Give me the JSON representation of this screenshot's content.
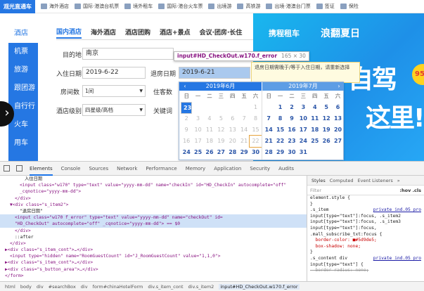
{
  "topnav": {
    "logo": "观光直通车",
    "items": [
      "海外酒店",
      "国际·港澳台机票",
      "境外租车",
      "国际·港台火车票",
      "出境游",
      "高铁游",
      "出境·港澳台门票",
      "签证",
      "保险"
    ]
  },
  "sidebar": {
    "items": [
      "酒店",
      "机票",
      "旅游",
      "跟团游",
      "自行行",
      "火车",
      "用车"
    ],
    "active": 0
  },
  "tabs": {
    "items": [
      "国内酒店",
      "海外酒店",
      "酒店团购",
      "酒店+景点",
      "会议·团房·长住"
    ],
    "active": 0
  },
  "form": {
    "destination_label": "目的地",
    "destination_value": "南京",
    "checkin_label": "入住日期",
    "checkin_value": "2019-6-22",
    "checkout_label": "退房日期",
    "checkout_value": "2019-6-21",
    "rooms_label": "房间数",
    "rooms_value": "1间",
    "guests_label": "住客数",
    "level_label": "酒店级别",
    "level_value": "四星级/高档",
    "keyword_label": "关键词"
  },
  "inspector_tooltip": {
    "selector": "input#HD_CheckOut.w170.f_error",
    "size": "165 × 30"
  },
  "error_tip": "退房日期需晚于/等于入住日期，请重新选择",
  "banner": {
    "brand": "携程租车",
    "slogan": "浪翻夏日",
    "big1": "自驾",
    "big2": "这里!",
    "badge": "95"
  },
  "calendar": {
    "left_title": "2019年6月",
    "right_title": "2019年7月",
    "weekdays": [
      "日",
      "一",
      "二",
      "三",
      "四",
      "五",
      "六"
    ],
    "left_days": [
      "",
      "",
      "",
      "",
      "",
      "",
      "1",
      "2",
      "3",
      "4",
      "5",
      "6",
      "7",
      "8",
      "9",
      "10",
      "11",
      "12",
      "13",
      "14",
      "15",
      "16",
      "17",
      "18",
      "19",
      "20",
      "21",
      "22",
      "23",
      "24",
      "25",
      "26",
      "27",
      "28",
      "29",
      "30",
      "",
      "",
      "",
      "",
      "",
      ""
    ],
    "right_days": [
      "",
      "1",
      "2",
      "3",
      "4",
      "5",
      "6",
      "7",
      "8",
      "9",
      "10",
      "11",
      "12",
      "13",
      "14",
      "15",
      "16",
      "17",
      "18",
      "19",
      "20",
      "21",
      "22",
      "23",
      "24",
      "25",
      "26",
      "27",
      "28",
      "29",
      "30",
      "31",
      "",
      "",
      ""
    ],
    "left_selected": "23",
    "left_range_start": "22",
    "prev_label": "‹",
    "next_label": "›"
  },
  "devtools": {
    "tabs": [
      "Elements",
      "Console",
      "Sources",
      "Network",
      "Performance",
      "Memory",
      "Application",
      "Security",
      "Audits"
    ],
    "active_tab": 0,
    "dom_lines": [
      {
        "indent": 10,
        "text": "入住日期",
        "kind": "text"
      },
      {
        "indent": 8,
        "text": "<input class=\"w170\" type=\"text\" value=\"yyyy-mm-dd\" name=\"checkIn\" id=\"HD_CheckIn\" autocomplete=\"off\"",
        "kind": "tag"
      },
      {
        "indent": 8,
        "text": "_cqnotice=\"yyyy-mm-dd\">",
        "kind": "tag"
      },
      {
        "indent": 6,
        "text": "</div>",
        "kind": "tag"
      },
      {
        "indent": 4,
        "text": "▼<div class=\"s_item2\">",
        "kind": "tag"
      },
      {
        "indent": 8,
        "text": "\"退房日期\"",
        "kind": "text"
      },
      {
        "indent": 6,
        "text": "<input class=\"w170 f_error\" type=\"text\" value=\"yyyy-mm-dd\" name=\"checkOut\" id=",
        "kind": "tag",
        "hl": true
      },
      {
        "indent": 6,
        "text": "\"HD_CheckOut\" autocomplete=\"off\" _cqnotice=\"yyyy-mm-dd\"> == $0",
        "kind": "tag",
        "hl": true
      },
      {
        "indent": 6,
        "text": "</div>",
        "kind": "tag"
      },
      {
        "indent": 6,
        "text": "::after",
        "kind": "text"
      },
      {
        "indent": 4,
        "text": "</div>",
        "kind": "tag"
      },
      {
        "indent": 2,
        "text": "▶<div class=\"s_item_cont\">…</div>",
        "kind": "tag"
      },
      {
        "indent": 4,
        "text": "<input type=\"hidden\" name=\"RoomGuestCount\" id=\"J_RoomGuestCount\" value=\"1,1,0\">",
        "kind": "tag"
      },
      {
        "indent": 2,
        "text": "▶<div class=\"s_item_cont\">…</div>",
        "kind": "tag"
      },
      {
        "indent": 2,
        "text": "▶<div class=\"s_button_area\">…</div>",
        "kind": "tag"
      },
      {
        "indent": 2,
        "text": "</form>",
        "kind": "tag"
      }
    ],
    "styles_tabs": [
      "Styles",
      "Computed",
      "Event Listeners",
      "»"
    ],
    "filter_placeholder": "Filter",
    "filter_buttons": ":hov  .cls",
    "style_rules": [
      {
        "text": "element.style {",
        "src": ""
      },
      {
        "text": "}",
        "src": ""
      },
      {
        "text": ".s_item",
        "src": "private_ind.05_pro"
      },
      {
        "text": "input[type=\"text\"]:focus, .s_item2",
        "src": ""
      },
      {
        "text": "input[type=\"text\"]:focus, .s_item3",
        "src": ""
      },
      {
        "text": "input[type=\"text\"]:focus,",
        "src": ""
      },
      {
        "text": ".mall_subscribe_txt:focus {",
        "src": ""
      },
      {
        "text": "  border-color: ■#5d9de5;",
        "src": "",
        "prop": true
      },
      {
        "text": "  box-shadow: none;",
        "src": "",
        "prop": true
      },
      {
        "text": "}",
        "src": ""
      },
      {
        "text": ".s_content div",
        "src": "private_ind.05_pro"
      },
      {
        "text": "input[type=\"text\"] {",
        "src": ""
      },
      {
        "text": "  border-radius: none;",
        "src": "",
        "strike": true
      }
    ],
    "breadcrumbs": [
      "html",
      "body",
      "div",
      "#searchBox",
      "div",
      "form#chinaHotelForm",
      "div.s_item_cont",
      "div.s_item2",
      "input#HD_CheckOut.w170.f_error"
    ],
    "active_crumb": 8
  }
}
